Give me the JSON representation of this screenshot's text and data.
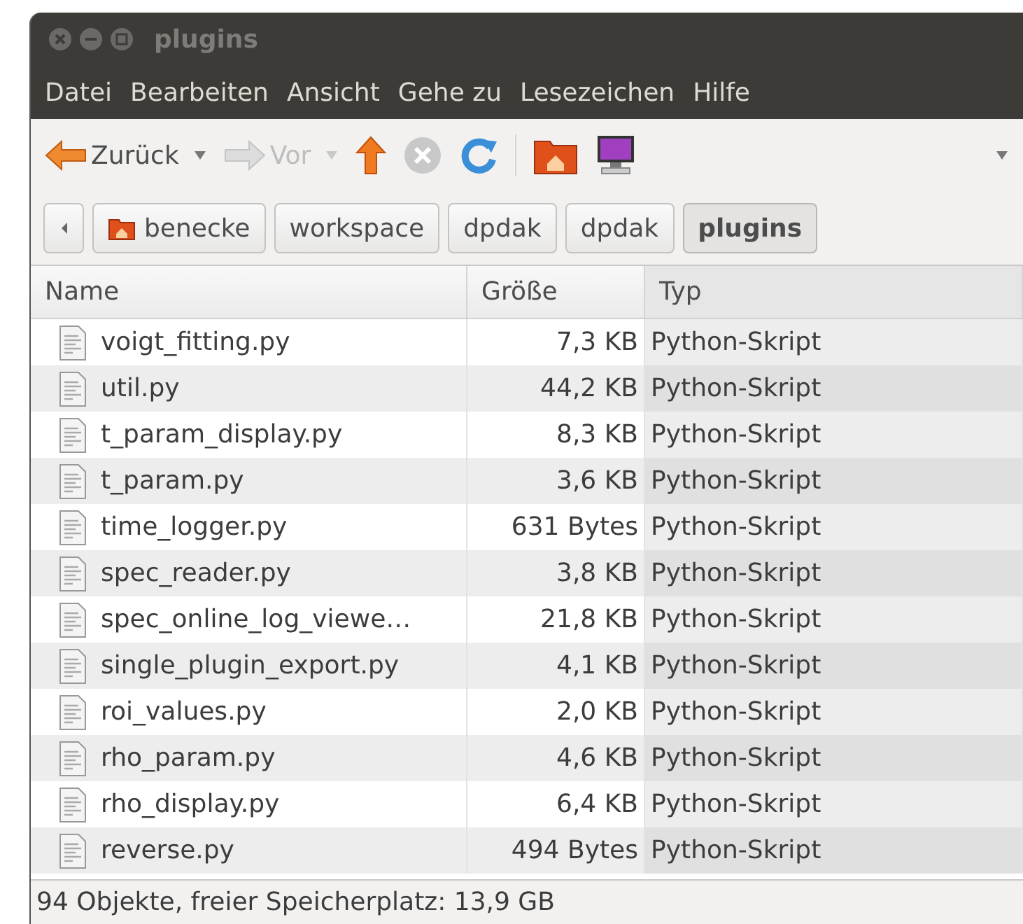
{
  "window": {
    "title": "plugins"
  },
  "menu": [
    "Datei",
    "Bearbeiten",
    "Ansicht",
    "Gehe zu",
    "Lesezeichen",
    "Hilfe"
  ],
  "toolbar": [
    {
      "kind": "back",
      "label": "Zurück",
      "disabled": false,
      "dropdown": true
    },
    {
      "kind": "forward",
      "label": "Vor",
      "disabled": true,
      "dropdown": true
    },
    {
      "kind": "up",
      "disabled": false
    },
    {
      "kind": "stop",
      "disabled": true
    },
    {
      "kind": "reload",
      "disabled": false
    },
    {
      "kind": "separator"
    },
    {
      "kind": "home",
      "disabled": false
    },
    {
      "kind": "computer",
      "disabled": false
    }
  ],
  "pathbar": [
    {
      "label": "benecke",
      "home": true,
      "selected": false
    },
    {
      "label": "workspace",
      "home": false,
      "selected": false
    },
    {
      "label": "dpdak",
      "home": false,
      "selected": false
    },
    {
      "label": "dpdak",
      "home": false,
      "selected": false
    },
    {
      "label": "plugins",
      "home": false,
      "selected": true
    }
  ],
  "table": {
    "columns": [
      {
        "label": "Name",
        "sorted": false
      },
      {
        "label": "Größe",
        "sorted": false
      },
      {
        "label": "Typ",
        "sorted": true
      }
    ],
    "rows": [
      [
        "voigt_fitting.py",
        "7,3 KB",
        "Python-Skript"
      ],
      [
        "util.py",
        "44,2 KB",
        "Python-Skript"
      ],
      [
        "t_param_display.py",
        "8,3 KB",
        "Python-Skript"
      ],
      [
        "t_param.py",
        "3,6 KB",
        "Python-Skript"
      ],
      [
        "time_logger.py",
        "631 Bytes",
        "Python-Skript"
      ],
      [
        "spec_reader.py",
        "3,8 KB",
        "Python-Skript"
      ],
      [
        "spec_online_log_viewe…",
        "21,8 KB",
        "Python-Skript"
      ],
      [
        "single_plugin_export.py",
        "4,1 KB",
        "Python-Skript"
      ],
      [
        "roi_values.py",
        "2,0 KB",
        "Python-Skript"
      ],
      [
        "rho_param.py",
        "4,6 KB",
        "Python-Skript"
      ],
      [
        "rho_display.py",
        "6,4 KB",
        "Python-Skript"
      ],
      [
        "reverse.py",
        "494 Bytes",
        "Python-Skript"
      ]
    ]
  },
  "status_bar": "94 Objekte, freier Speicherplatz: 13,9 GB"
}
